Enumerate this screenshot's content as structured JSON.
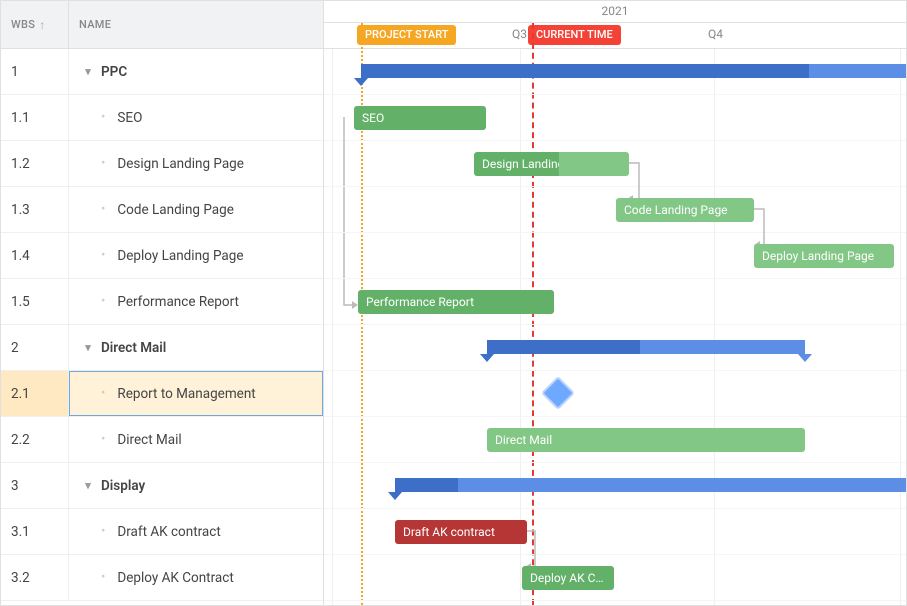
{
  "columns": {
    "wbs": "WBS",
    "name": "NAME"
  },
  "timeline": {
    "year": "2021",
    "q3": "Q3",
    "q4": "Q4",
    "project_start": "PROJECT START",
    "current_time": "CURRENT TIME"
  },
  "rows": [
    {
      "wbs": "1",
      "name": "PPC",
      "parent": true
    },
    {
      "wbs": "1.1",
      "name": "SEO"
    },
    {
      "wbs": "1.2",
      "name": "Design Landing Page"
    },
    {
      "wbs": "1.3",
      "name": "Code Landing Page"
    },
    {
      "wbs": "1.4",
      "name": "Deploy Landing Page"
    },
    {
      "wbs": "1.5",
      "name": "Performance Report"
    },
    {
      "wbs": "2",
      "name": "Direct Mail",
      "parent": true
    },
    {
      "wbs": "2.1",
      "name": "Report to Management",
      "selected": true
    },
    {
      "wbs": "2.2",
      "name": "Direct Mail"
    },
    {
      "wbs": "3",
      "name": "Display",
      "parent": true
    },
    {
      "wbs": "3.1",
      "name": "Draft AK contract"
    },
    {
      "wbs": "3.2",
      "name": "Deploy AK Contract"
    }
  ],
  "bars": {
    "seo": "SEO",
    "design": "Design Landing Page",
    "code": "Code Landing Page",
    "deploy": "Deploy Landing Page",
    "perf": "Performance Report",
    "directmail": "Direct Mail",
    "draft": "Draft AK contract",
    "deployak": "Deploy AK C…"
  },
  "chart_data": {
    "type": "gantt",
    "time_axis": {
      "year": 2021,
      "quarters": [
        "Q3",
        "Q4"
      ]
    },
    "markers": [
      {
        "name": "PROJECT START",
        "approx_position": "early Q3"
      },
      {
        "name": "CURRENT TIME",
        "approx_position": "mid Q3"
      }
    ],
    "tasks": [
      {
        "wbs": "1",
        "name": "PPC",
        "type": "summary",
        "progress_pct": 80
      },
      {
        "wbs": "1.1",
        "name": "SEO",
        "type": "task",
        "progress_pct": 100
      },
      {
        "wbs": "1.2",
        "name": "Design Landing Page",
        "type": "task",
        "progress_pct": 55
      },
      {
        "wbs": "1.3",
        "name": "Code Landing Page",
        "type": "task",
        "progress_pct": 0
      },
      {
        "wbs": "1.4",
        "name": "Deploy Landing Page",
        "type": "task",
        "progress_pct": 0
      },
      {
        "wbs": "1.5",
        "name": "Performance Report",
        "type": "task",
        "progress_pct": 100
      },
      {
        "wbs": "2",
        "name": "Direct Mail",
        "type": "summary",
        "progress_pct": 48
      },
      {
        "wbs": "2.1",
        "name": "Report to Management",
        "type": "milestone"
      },
      {
        "wbs": "2.2",
        "name": "Direct Mail",
        "type": "task",
        "progress_pct": 0
      },
      {
        "wbs": "3",
        "name": "Display",
        "type": "summary",
        "progress_pct": 12
      },
      {
        "wbs": "3.1",
        "name": "Draft AK contract",
        "type": "task",
        "progress_pct": 100,
        "highlight": "red"
      },
      {
        "wbs": "3.2",
        "name": "Deploy AK Contract",
        "type": "task",
        "progress_pct": 100
      }
    ],
    "dependencies": [
      [
        "1.1",
        "1.2"
      ],
      [
        "1.2",
        "1.3"
      ],
      [
        "1.3",
        "1.4"
      ],
      [
        "1.1",
        "1.5"
      ],
      [
        "3.1",
        "3.2"
      ]
    ]
  }
}
